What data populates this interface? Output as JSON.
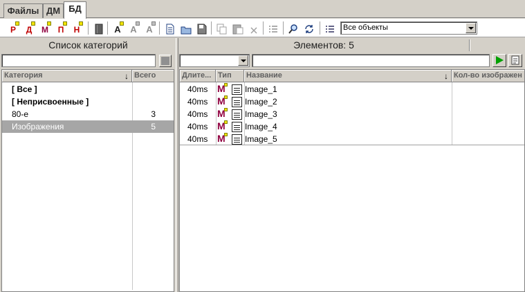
{
  "tabs": [
    "Файлы",
    "ДМ",
    "БД"
  ],
  "toolbar": {
    "letter_buttons": [
      "Р",
      "Д",
      "М",
      "П",
      "Н"
    ],
    "a_buttons": [
      "A",
      "A",
      "A"
    ],
    "filter_value": "Все объекты"
  },
  "left": {
    "title": "Список категорий",
    "columns": {
      "category": "Категория",
      "total": "Всего"
    },
    "rows": [
      {
        "name": "[ Все ]",
        "count": ""
      },
      {
        "name": "[ Неприсвоенные ]",
        "count": ""
      },
      {
        "name": "80-е",
        "count": "3"
      },
      {
        "name": "Изображения",
        "count": "5"
      }
    ]
  },
  "right": {
    "title": "Элементов: 5",
    "columns": {
      "duration": "Длите...",
      "type": "Тип",
      "name": "Название",
      "count": "Кол-во изображен"
    },
    "rows": [
      {
        "duration": "40ms",
        "name": "Image_1"
      },
      {
        "duration": "40ms",
        "name": "Image_2"
      },
      {
        "duration": "40ms",
        "name": "Image_3"
      },
      {
        "duration": "40ms",
        "name": "Image_4"
      },
      {
        "duration": "40ms",
        "name": "Image_5"
      }
    ]
  },
  "icons": {
    "sort": "sort-down-arrow",
    "play": "play-icon",
    "list": "list-icon"
  },
  "colors": {
    "selection": "#a6a6a6",
    "play_green": "#00a000",
    "letter_red": "#c00000",
    "letter_maroon": "#900040"
  }
}
